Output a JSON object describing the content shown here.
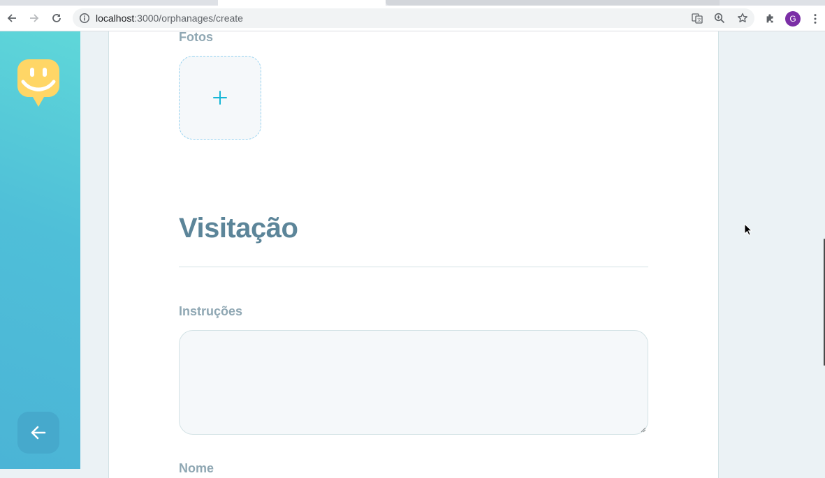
{
  "browser": {
    "url_host": "localhost",
    "url_path": ":3000/orphanages/create",
    "avatar_letter": "G"
  },
  "sidebar": {
    "logo_icon": "happy-face-logo",
    "back_icon": "arrow-left-icon",
    "colors": {
      "gradient_start": "#5fd7d9",
      "gradient_end": "#4bb4d6",
      "logo": "#ffd666"
    }
  },
  "form": {
    "photos_label": "Fotos",
    "add_photo_icon": "plus-icon",
    "section_title": "Visitação",
    "instructions_label": "Instruções",
    "instructions_value": "",
    "next_label": "Nome",
    "colors": {
      "title": "#5c8599",
      "label": "#8fa7b3",
      "accent": "#15b6d6"
    }
  }
}
